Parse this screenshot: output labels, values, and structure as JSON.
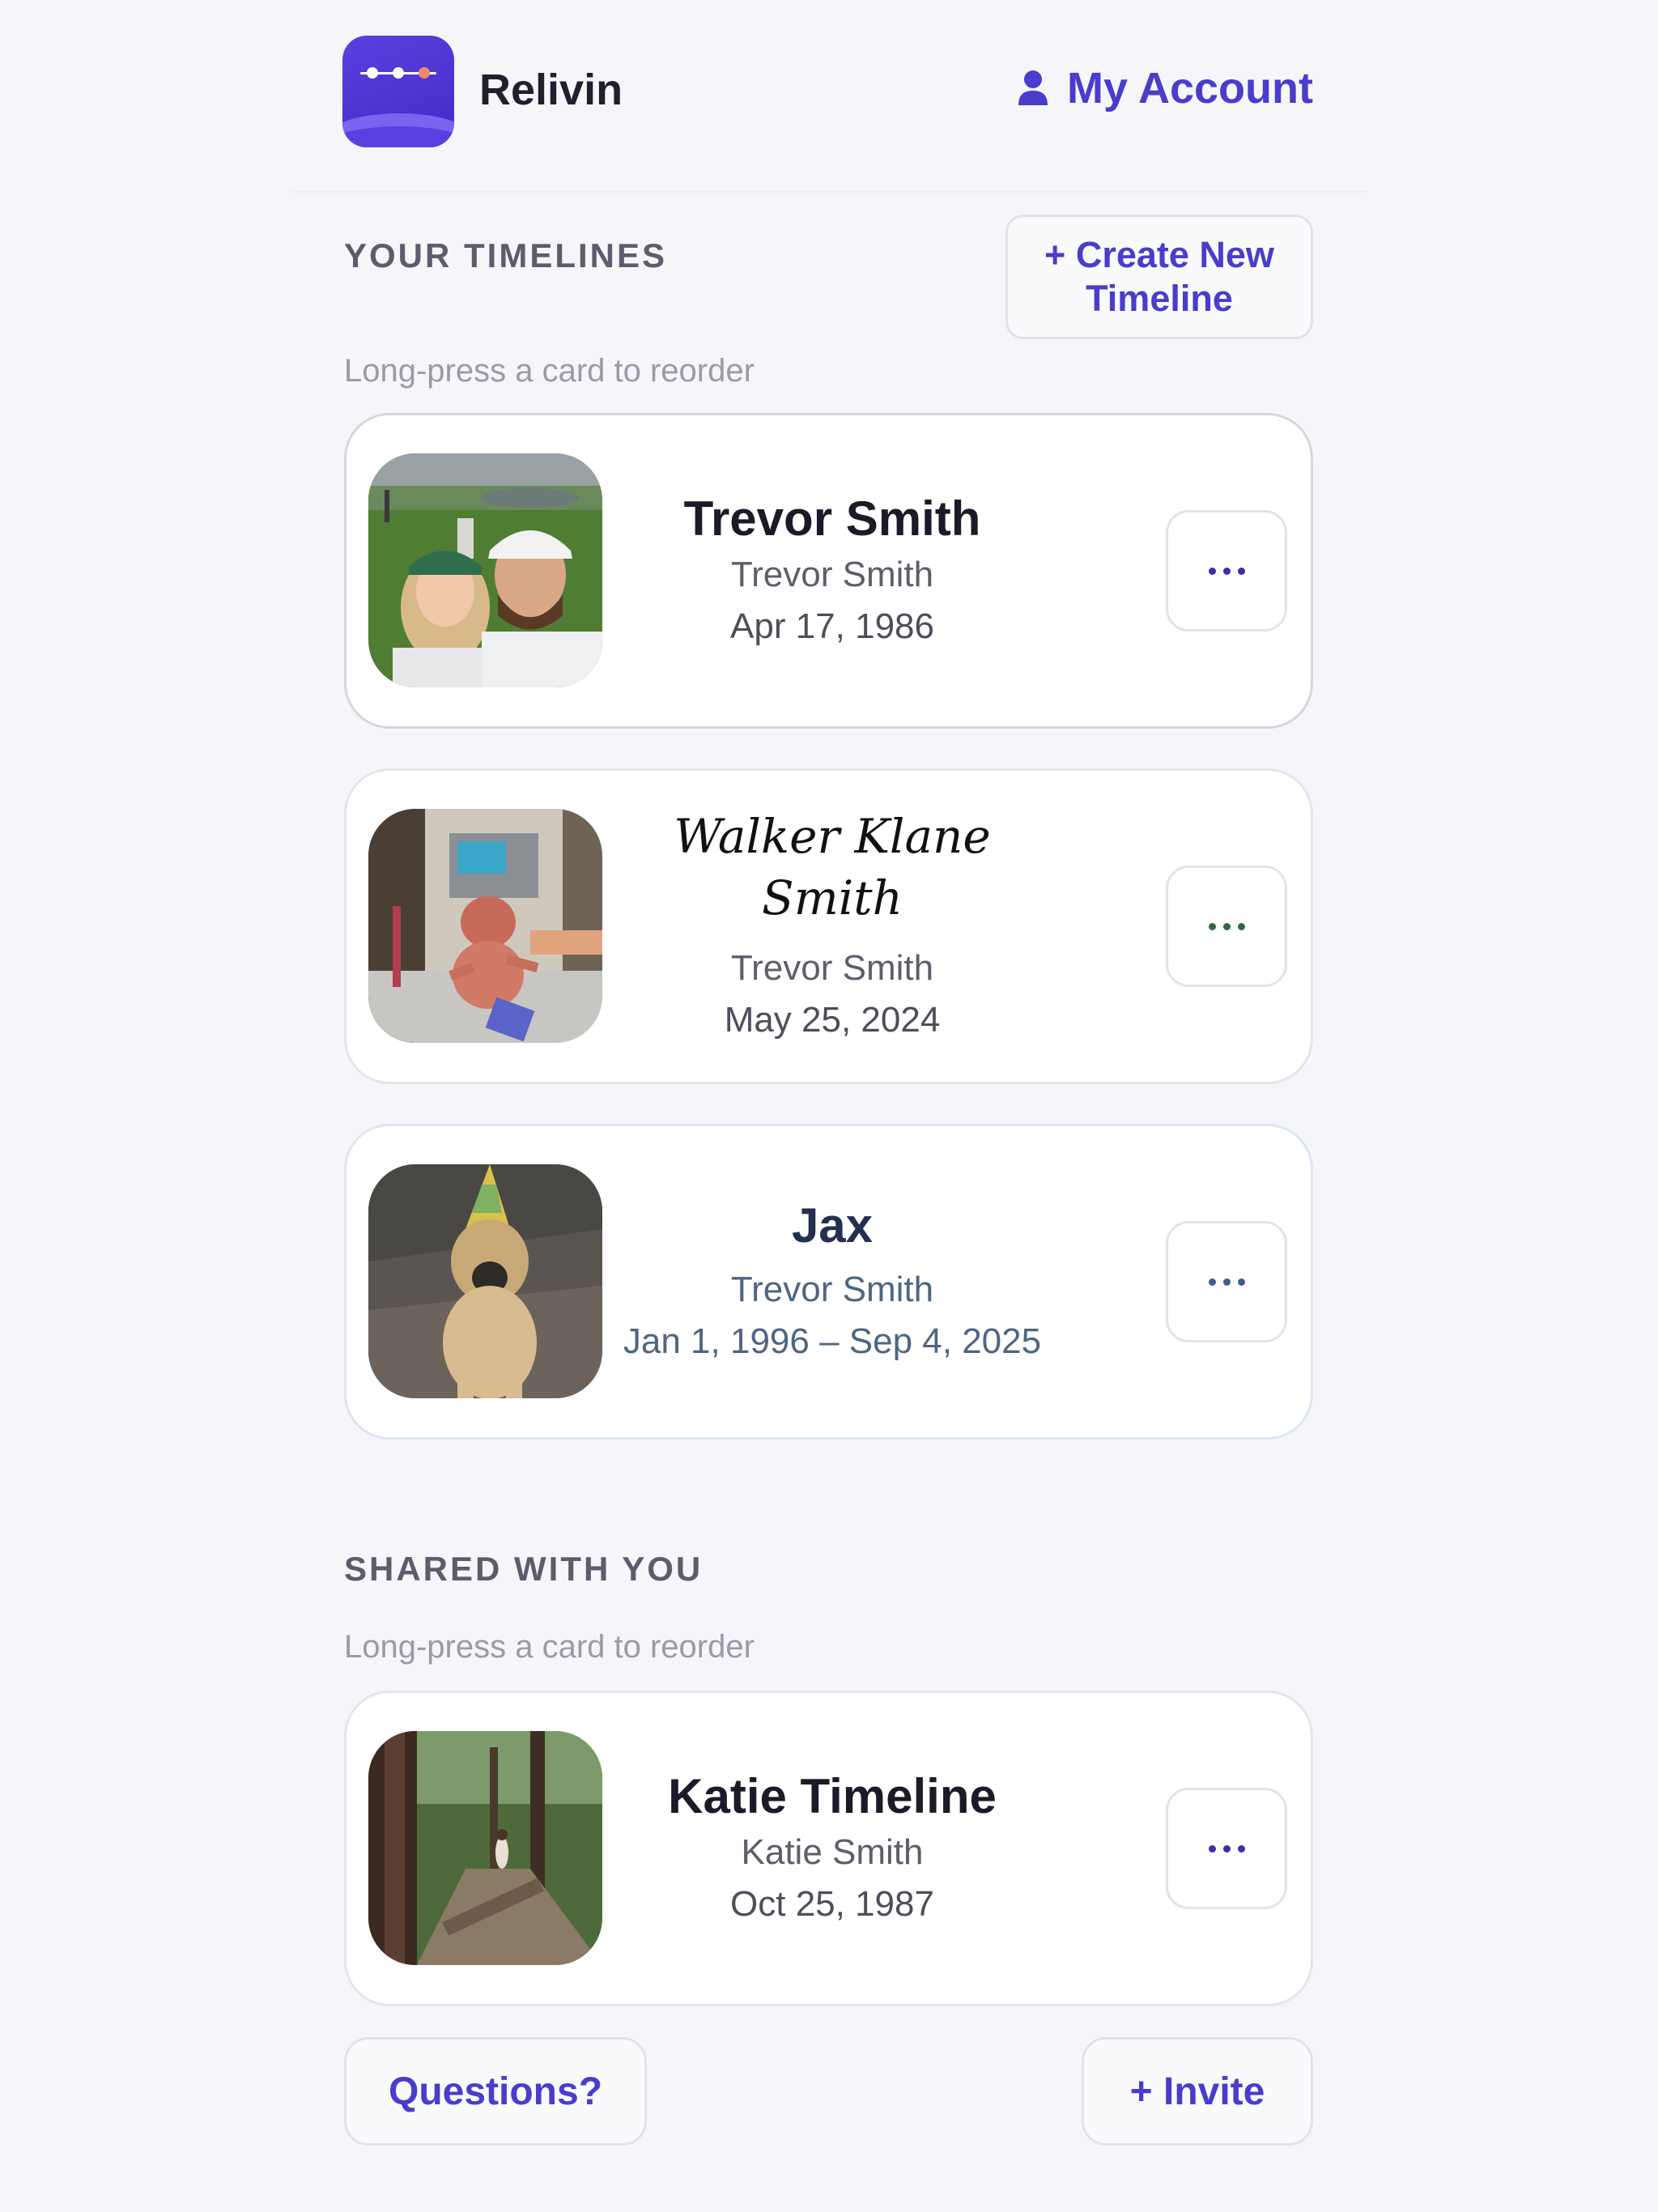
{
  "header": {
    "app_name": "Relivin",
    "account_label": "My Account"
  },
  "your_timelines": {
    "title": "YOUR TIMELINES",
    "create_label": "+ Create New Timeline",
    "hint": "Long-press a card to reorder",
    "cards": [
      {
        "title": "Trevor Smith",
        "owner": "Trevor Smith",
        "date": "Apr 17, 1986",
        "photo": "couple-selfie-golf-course"
      },
      {
        "title": "Walker Klane Smith",
        "owner": "Trevor Smith",
        "date": "May 25, 2024",
        "photo": "newborn-in-hospital-warmer"
      },
      {
        "title": "Jax",
        "owner": "Trevor Smith",
        "date": "Jan 1, 1996 – Sep 4, 2025",
        "photo": "dog-with-party-hat"
      }
    ]
  },
  "shared_with_you": {
    "title": "SHARED WITH YOU",
    "hint": "Long-press a card to reorder",
    "cards": [
      {
        "title": "Katie Timeline",
        "owner": "Katie Smith",
        "date": "Oct 25, 1987",
        "photo": "child-on-forest-trail"
      }
    ]
  },
  "footer": {
    "questions_label": "Questions?",
    "invite_label": "+ Invite"
  },
  "icons": {
    "account": "user-icon",
    "more": "more-horizontal-icon"
  },
  "colors": {
    "accent": "#4a3ccc",
    "background": "#f6f6fa"
  }
}
